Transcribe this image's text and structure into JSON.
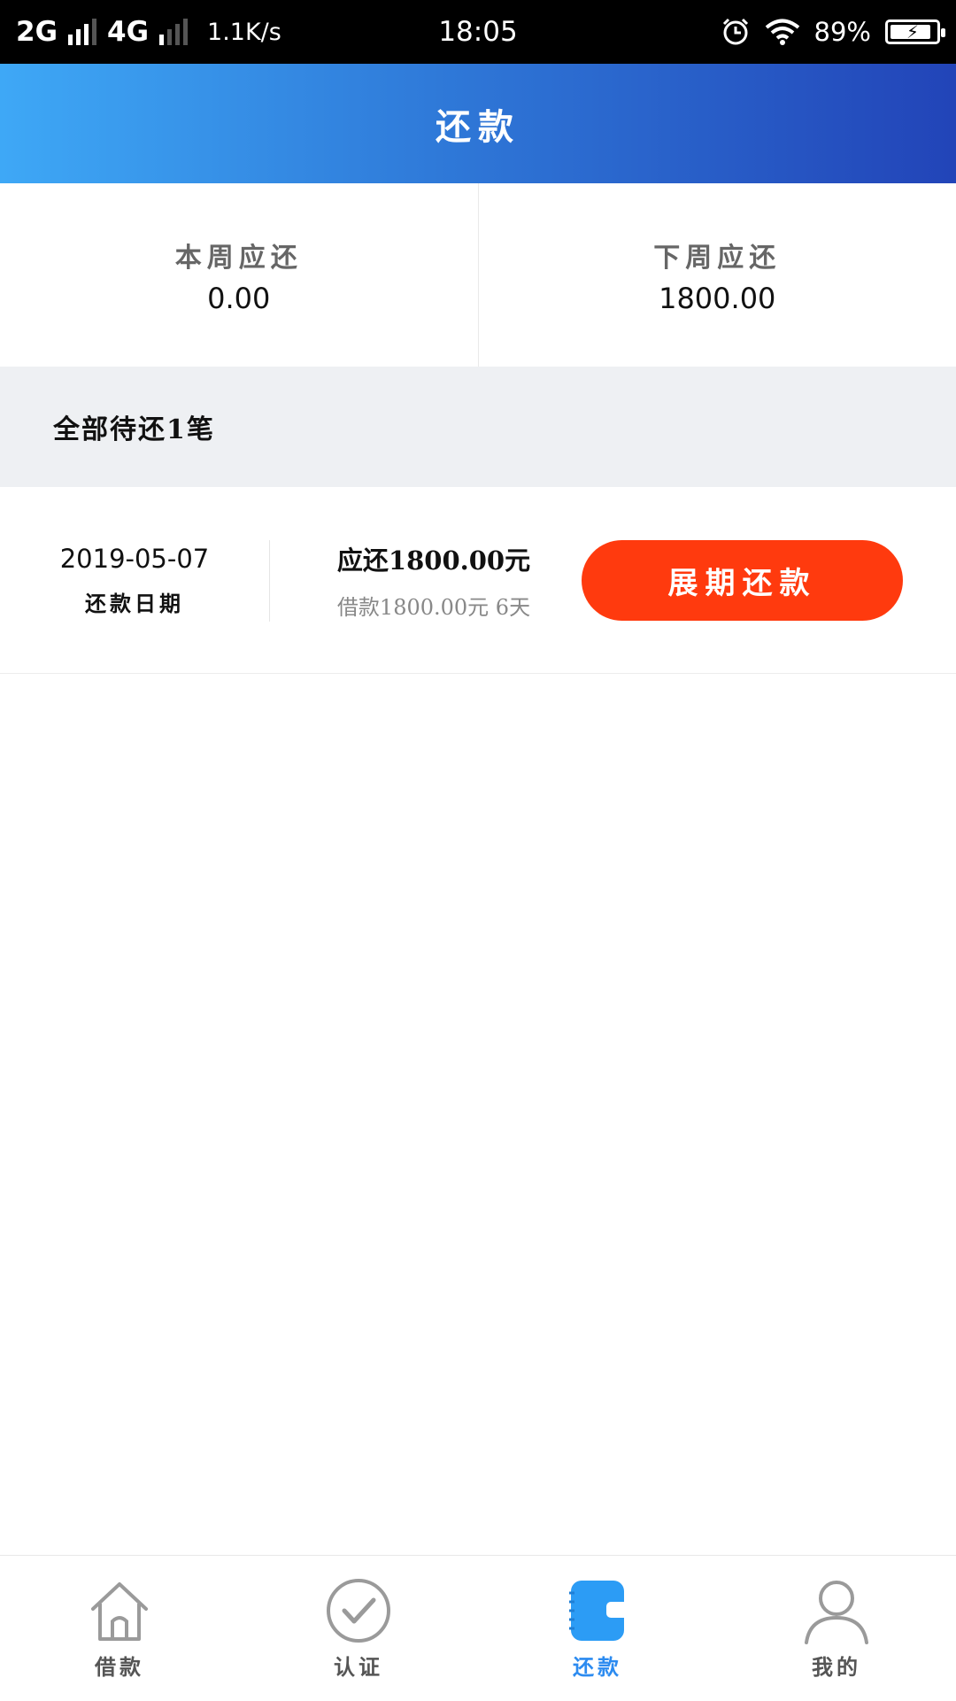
{
  "status_bar": {
    "net1": "2G",
    "net2": "4G",
    "speed": "1.1K/s",
    "time": "18:05",
    "battery": "89%",
    "battery_level": 0.89
  },
  "header": {
    "title": "还款"
  },
  "summary": {
    "this_week_label": "本周应还",
    "this_week_value": "0.00",
    "next_week_label": "下周应还",
    "next_week_value": "1800.00"
  },
  "section": {
    "title": "全部待还1笔"
  },
  "loan": {
    "due_date": "2019-05-07",
    "due_date_label": "还款日期",
    "amount_due": "应还1800.00元",
    "amount_detail": "借款1800.00元 6天",
    "renew_button": "展期还款"
  },
  "nav": {
    "items": [
      {
        "label": "借款",
        "icon": "house-icon"
      },
      {
        "label": "认证",
        "icon": "check-circle-icon"
      },
      {
        "label": "还款",
        "icon": "wallet-icon"
      },
      {
        "label": "我的",
        "icon": "user-icon"
      }
    ],
    "active_index": 2,
    "active_color": "#2c8bf0"
  },
  "colors": {
    "header_gradient_start": "#3ea8f6",
    "header_gradient_end": "#2244b8",
    "button": "#ff3a0e",
    "section_bg": "#eef0f3"
  }
}
